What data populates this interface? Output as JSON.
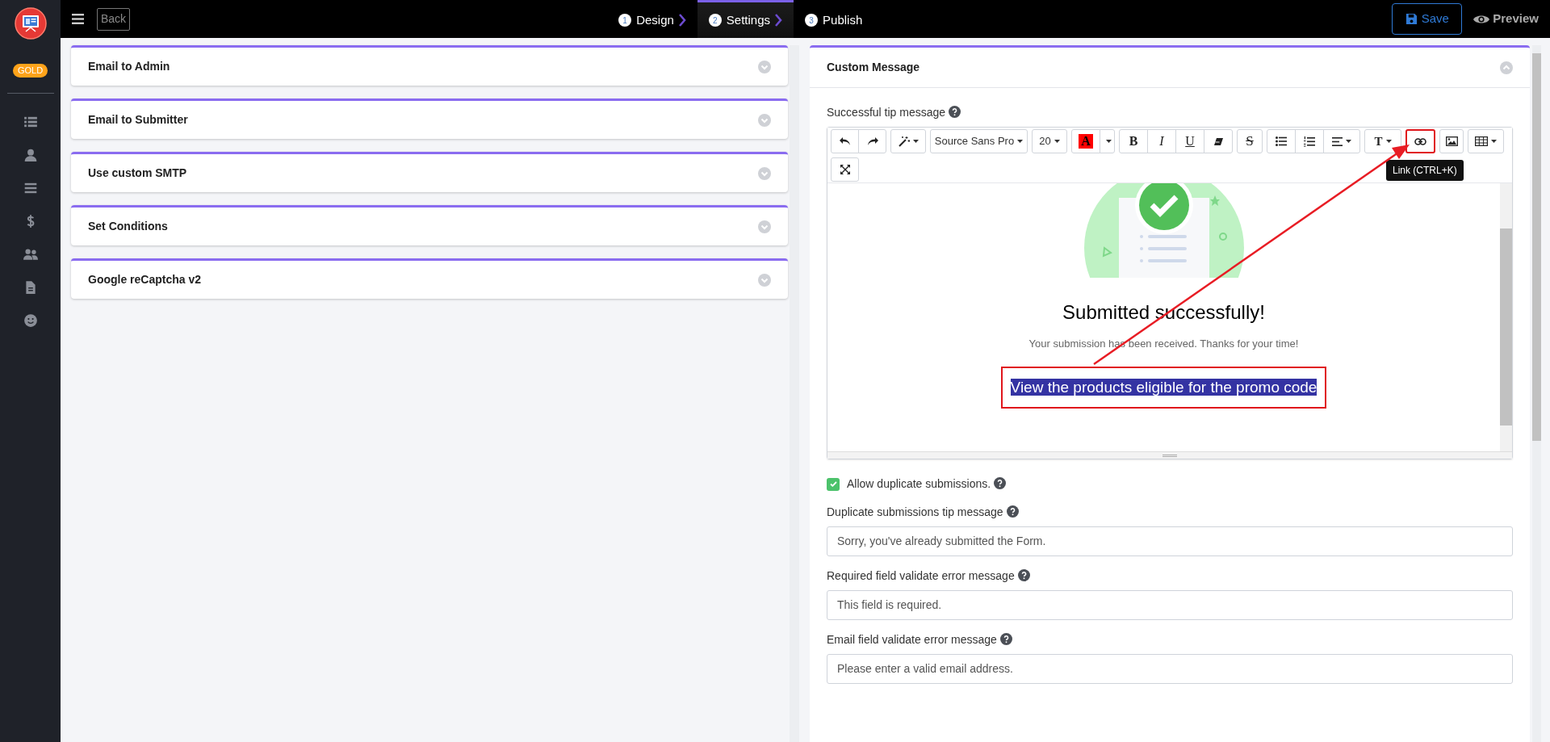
{
  "sidebar": {
    "badge": "GOLD"
  },
  "topbar": {
    "back": "Back",
    "save": "Save",
    "preview": "Preview",
    "steps": [
      {
        "number": "1",
        "label": "Design",
        "selected": false
      },
      {
        "number": "2",
        "label": "Settings",
        "selected": true
      },
      {
        "number": "3",
        "label": "Publish",
        "selected": false
      }
    ]
  },
  "left_panels": [
    {
      "title": "Email to Admin",
      "expanded": false
    },
    {
      "title": "Email to Submitter",
      "expanded": false
    },
    {
      "title": "Use custom SMTP",
      "expanded": false
    },
    {
      "title": "Set Conditions",
      "expanded": false
    },
    {
      "title": "Google reCaptcha v2",
      "expanded": false
    }
  ],
  "custom_message": {
    "title": "Custom Message",
    "expanded": true,
    "success_label": "Successful tip message",
    "toolbar_groups": [
      [
        {
          "kind": "undo",
          "highlighted": false
        },
        {
          "kind": "redo",
          "highlighted": false
        }
      ],
      [
        {
          "kind": "magic",
          "highlighted": false
        }
      ],
      [
        {
          "kind": "font",
          "label": "Source Sans Pro",
          "highlighted": false
        }
      ],
      [
        {
          "kind": "size",
          "label": "20",
          "highlighted": false
        }
      ],
      [
        {
          "kind": "color",
          "label": "A",
          "highlighted": false
        },
        {
          "kind": "caret",
          "highlighted": false
        }
      ],
      [
        {
          "kind": "bold",
          "label": "B",
          "highlighted": false
        },
        {
          "kind": "italic",
          "label": "I",
          "highlighted": false
        },
        {
          "kind": "underline",
          "label": "U",
          "highlighted": false
        },
        {
          "kind": "eraser",
          "highlighted": false
        }
      ],
      [
        {
          "kind": "strike",
          "label": "S",
          "highlighted": false
        }
      ],
      [
        {
          "kind": "ul",
          "highlighted": false
        },
        {
          "kind": "ol",
          "highlighted": false
        },
        {
          "kind": "align",
          "highlighted": false
        }
      ],
      [
        {
          "kind": "textstyle",
          "label": "T",
          "highlighted": false
        }
      ],
      [
        {
          "kind": "link",
          "highlighted": true
        }
      ],
      [
        {
          "kind": "image",
          "highlighted": false
        }
      ],
      [
        {
          "kind": "table",
          "highlighted": false
        }
      ],
      [
        {
          "kind": "expand",
          "highlighted": false
        }
      ]
    ],
    "tooltip": "Link (CTRL+K)",
    "content": {
      "title": "Submitted successfully!",
      "message": "Your submission has been received. Thanks for your time!",
      "link_text": "View the products eligible for the promo code",
      "link_selected": true,
      "link_boxed": true
    },
    "duplicate": {
      "label": "Allow duplicate submissions.",
      "checked": true
    },
    "fields": [
      {
        "label": "Duplicate submissions tip message",
        "value": "Sorry, you've already submitted the Form."
      },
      {
        "label": "Required field validate error message",
        "value": "This field is required."
      },
      {
        "label": "Email field validate error message",
        "value": "Please enter a valid email address."
      }
    ]
  },
  "annotation_arrow": true
}
